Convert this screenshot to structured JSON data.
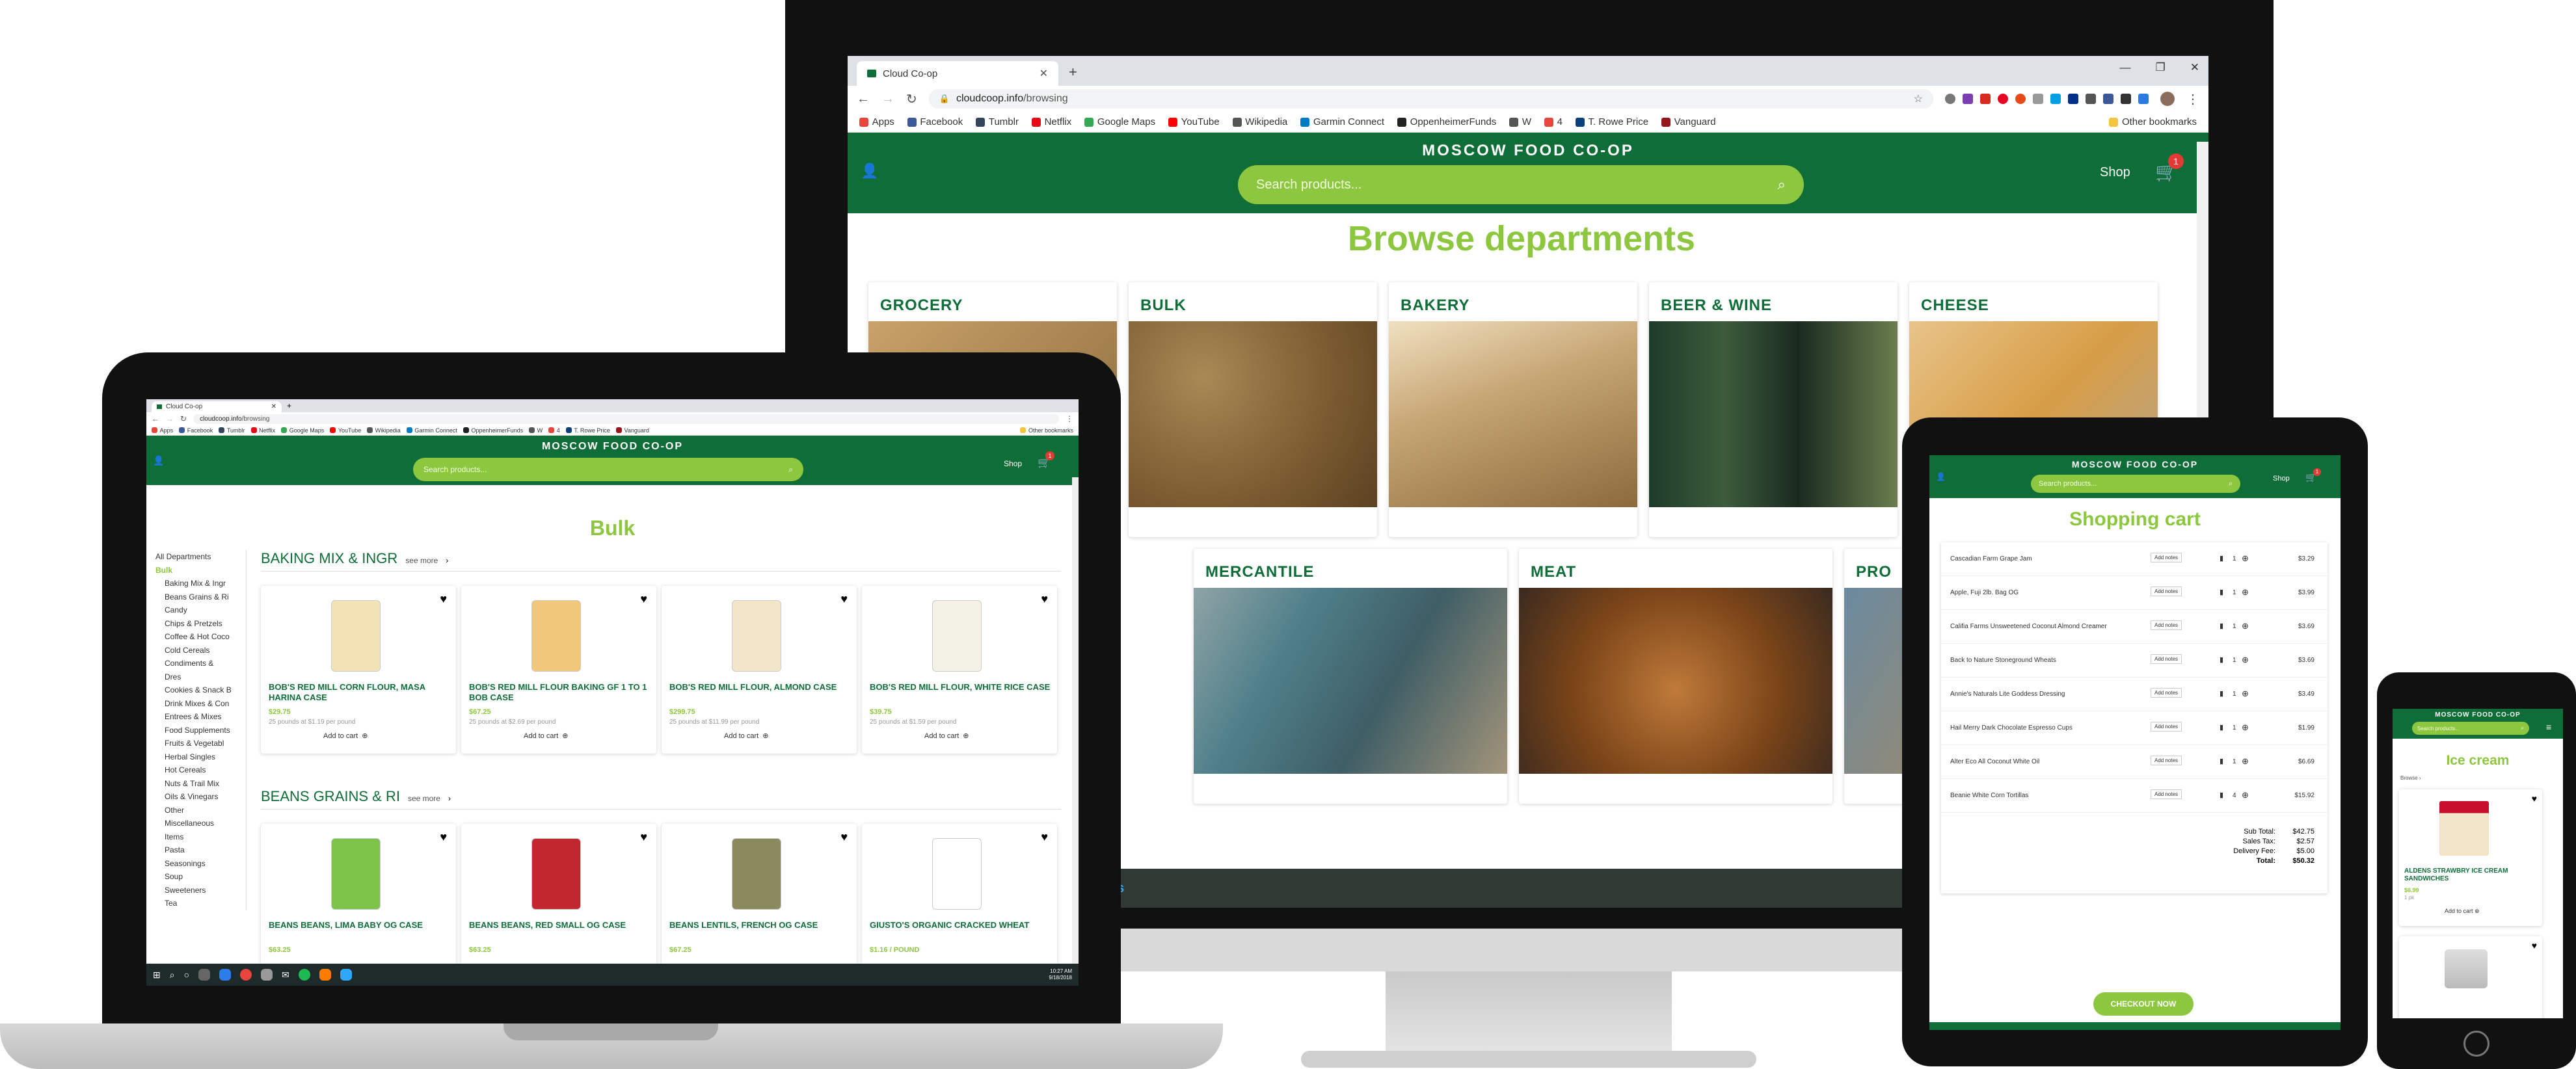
{
  "browser": {
    "tab_title": "Cloud Co-op",
    "url_host": "cloudcoop.info",
    "url_path": "/browsing",
    "bookmarks": [
      "Apps",
      "Facebook",
      "Tumblr",
      "Netflix",
      "Google Maps",
      "YouTube",
      "Wikipedia",
      "Garmin Connect",
      "OppenheimerFunds",
      "W",
      "4",
      "T. Rowe Price",
      "Vanguard"
    ],
    "other_bookmarks": "Other bookmarks",
    "bookmark_colors": [
      "#e8453c",
      "#3b5998",
      "#35465c",
      "#e50914",
      "#34a853",
      "#ff0000",
      "#555555",
      "#007cc3",
      "#222222",
      "#555555",
      "#e8453c",
      "#0a3f7a",
      "#96151d"
    ]
  },
  "store": {
    "name": "MOSCOW FOOD CO-OP",
    "search_placeholder": "Search products...",
    "shop_label": "Shop",
    "cart_count": "1",
    "brand_dark": "#0f6d38",
    "brand_light": "#8dc63f"
  },
  "desktop": {
    "heading": "Browse departments",
    "departments_row1": [
      "GROCERY",
      "BULK",
      "BAKERY",
      "BEER & WINE",
      "CHEESE"
    ],
    "departments_row2": [
      "MERCANTILE",
      "MEAT",
      "PRO"
    ]
  },
  "laptop": {
    "heading": "Bulk",
    "sidebar_top": "All Departments",
    "sidebar_current": "Bulk",
    "sidebar_items": [
      "Baking Mix & Ingr",
      "Beans Grains & Ri",
      "Candy",
      "Chips & Pretzels",
      "Coffee & Hot Coco",
      "Cold Cereals",
      "Condiments &",
      "Dres",
      "Cookies & Snack B",
      "Drink Mixes & Con",
      "Entrees & Mixes",
      "Food Supplements",
      "Fruits & Vegetabl",
      "Herbal Singles",
      "Hot Cereals",
      "Nuts & Trail Mix",
      "Oils & Vinegars",
      "Other",
      "Miscellaneous",
      "Items",
      "Pasta",
      "Seasonings",
      "Soup",
      "Sweeteners",
      "Tea"
    ],
    "section1_title": "BAKING MIX & INGR",
    "section2_title": "BEANS GRAINS & RI",
    "see_more": "see more",
    "add_to_cart": "Add to cart",
    "products1": [
      {
        "name": "BOB'S RED MILL CORN FLOUR, MASA HARINA CASE",
        "price": "$29.75",
        "unit": "25 pounds at $1.19 per pound"
      },
      {
        "name": "BOB'S RED MILL FLOUR BAKING GF 1 TO 1 BOB CASE",
        "price": "$67.25",
        "unit": "25 pounds at $2.69 per pound"
      },
      {
        "name": "BOB'S RED MILL FLOUR, ALMOND CASE",
        "price": "$299.75",
        "unit": "25 pounds at $11.99 per pound"
      },
      {
        "name": "BOB'S RED MILL FLOUR, WHITE RICE CASE",
        "price": "$39.75",
        "unit": "25 pounds at $1.59 per pound"
      }
    ],
    "products2": [
      {
        "name": "BEANS BEANS, LIMA BABY OG CASE",
        "price": "$63.25"
      },
      {
        "name": "BEANS BEANS, RED SMALL OG CASE",
        "price": "$63.25"
      },
      {
        "name": "BEANS LENTILS, FRENCH OG CASE",
        "price": "$67.25"
      },
      {
        "name": "GIUSTO'S ORGANIC CRACKED WHEAT",
        "price": "$1.16 / POUND"
      }
    ],
    "clock_time": "10:27 AM",
    "clock_date": "9/18/2018"
  },
  "tablet": {
    "heading": "Shopping cart",
    "add_notes": "Add notes",
    "items": [
      {
        "name": "Cascadian Farm Grape Jam",
        "qty": "1",
        "price": "$3.29"
      },
      {
        "name": "Apple, Fuji 2lb. Bag OG",
        "qty": "1",
        "price": "$3.99"
      },
      {
        "name": "Califia Farms Unsweetened Coconut Almond Creamer",
        "qty": "1",
        "price": "$3.69"
      },
      {
        "name": "Back to Nature Stoneground Wheats",
        "qty": "1",
        "price": "$3.69"
      },
      {
        "name": "Annie's Naturals Lite Goddess Dressing",
        "qty": "1",
        "price": "$3.49"
      },
      {
        "name": "Hail Merry Dark Chocolate Espresso Cups",
        "qty": "1",
        "price": "$1.99"
      },
      {
        "name": "Alter Eco All Coconut White Oil",
        "qty": "1",
        "price": "$6.69"
      },
      {
        "name": "Beanie White Corn Tortillas",
        "qty": "4",
        "price": "$15.92"
      }
    ],
    "totals": [
      {
        "label": "Sub Total:",
        "value": "$42.75"
      },
      {
        "label": "Sales Tax:",
        "value": "$2.57"
      },
      {
        "label": "Delivery Fee:",
        "value": "$5.00"
      },
      {
        "label": "Total:",
        "value": "$50.32"
      }
    ],
    "checkout": "CHECKOUT NOW"
  },
  "phone": {
    "heading": "Ice cream",
    "crumb": "Browse",
    "product_name": "ALDENS STRAWBRY ICE CREAM SANDWICHES",
    "product_price": "$6.99",
    "product_unit": "1 pk",
    "add_to_cart": "Add to cart"
  }
}
